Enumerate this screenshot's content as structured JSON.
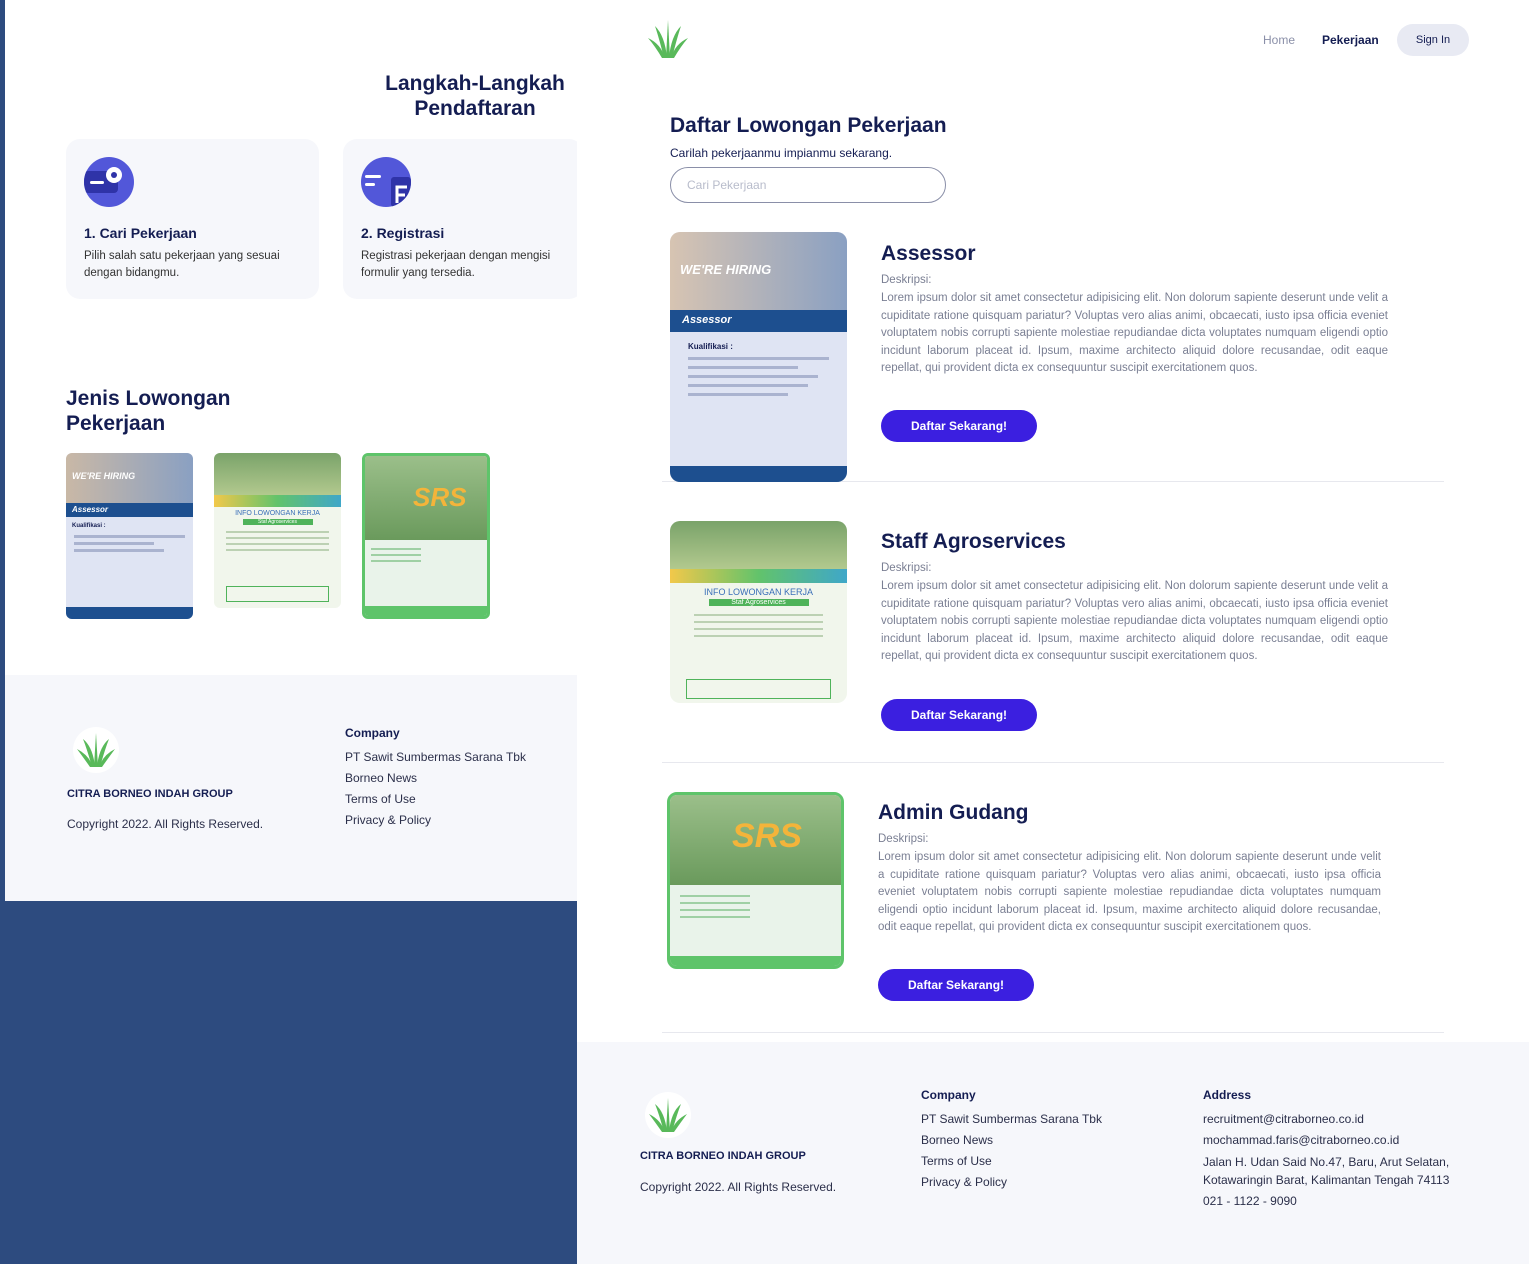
{
  "colors": {
    "accent": "#3b1fe0",
    "navy": "#141d52",
    "bg": "#2d4b7f",
    "icon": "#5257d9",
    "green": "#5ec46a"
  },
  "left": {
    "steps_title": "Langkah-Langkah Pendaftaran",
    "steps": [
      {
        "icon": "search-doc-icon",
        "title": "1. Cari Pekerjaan",
        "desc": "Pilih salah satu pekerjaan yang sesuai dengan bidangmu."
      },
      {
        "icon": "form-doc-icon",
        "title": "2. Registrasi",
        "desc": "Registrasi pekerjaan dengan mengisi formulir yang tersedia."
      }
    ],
    "jobs_title": "Jenis Lowongan Pekerjaan",
    "thumbs": [
      {
        "hiring": "WE'RE HIRING",
        "role": "Assessor",
        "qual": "Kualifikasi :"
      },
      {
        "banner": "INFO LOWONGAN KERJA",
        "sub": "Staf Agroservices"
      },
      {
        "logo": "SRS"
      }
    ]
  },
  "footer": {
    "brand": "CITRA BORNEO INDAH GROUP",
    "copyright": "Copyright 2022. All Rights Reserved.",
    "company_head": "Company",
    "company_links": [
      "PT Sawit Sumbermas Sarana Tbk",
      "Borneo News",
      "Terms of Use",
      "Privacy & Policy"
    ],
    "address_head": "Address",
    "address": [
      "recruitment@citraborneo.co.id",
      "mochammad.faris@citraborneo.co.id",
      "Jalan H. Udan Said No.47, Baru, Arut Selatan,",
      "Kotawaringin Barat, Kalimantan Tengah 74113",
      "021 - 1122 - 9090"
    ]
  },
  "nav": {
    "home": "Home",
    "jobs": "Pekerjaan",
    "signin": "Sign In"
  },
  "listing": {
    "title": "Daftar Lowongan Pekerjaan",
    "subtitle": "Carilah pekerjaanmu impianmu sekarang.",
    "search_placeholder": "Cari Pekerjaan",
    "desc_label": "Deskripsi:",
    "desc_text": "Lorem ipsum dolor sit amet consectetur adipisicing elit. Non dolorum sapiente deserunt unde velit a cupiditate ratione quisquam pariatur? Voluptas vero alias animi, obcaecati, iusto ipsa officia eveniet voluptatem nobis corrupti sapiente molestiae repudiandae dicta voluptates numquam eligendi optio incidunt laborum placeat id. Ipsum, maxime architecto aliquid dolore recusandae, odit eaque repellat, qui provident dicta ex consequuntur suscipit exercitationem quos.",
    "button": "Daftar Sekarang!",
    "jobs": [
      {
        "title": "Assessor",
        "poster": {
          "hiring": "WE'RE HIRING",
          "role": "Assessor",
          "qual": "Kualifikasi :"
        }
      },
      {
        "title": "Staff Agroservices",
        "poster": {
          "banner": "INFO LOWONGAN KERJA",
          "sub": "Staf Agroservices"
        }
      },
      {
        "title": "Admin Gudang",
        "poster": {
          "logo": "SRS"
        }
      }
    ]
  }
}
